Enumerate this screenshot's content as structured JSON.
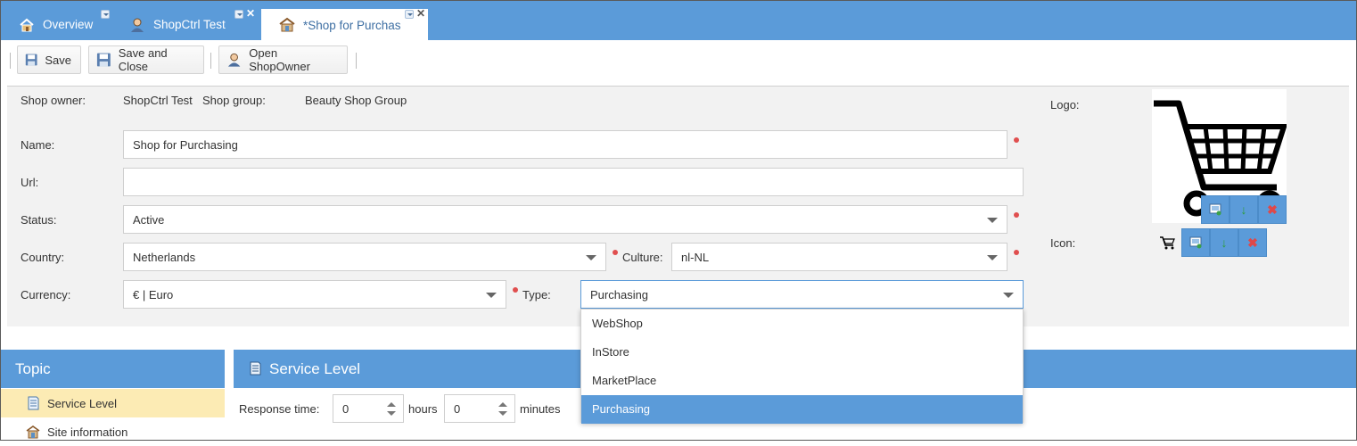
{
  "tabs": [
    {
      "label": "Overview",
      "icon": "house-icon"
    },
    {
      "label": "ShopCtrl Test",
      "icon": "user-icon"
    },
    {
      "label": "*Shop for Purchas",
      "icon": "shop-icon"
    }
  ],
  "toolbar": {
    "save_label": "Save",
    "save_close_label": "Save and Close",
    "open_owner_label": "Open ShopOwner"
  },
  "form": {
    "shop_owner_label": "Shop owner:",
    "shop_owner_value": "ShopCtrl Test",
    "shop_group_label": "Shop group:",
    "shop_group_value": "Beauty Shop Group",
    "name_label": "Name:",
    "name_value": "Shop for Purchasing",
    "url_label": "Url:",
    "url_value": "",
    "status_label": "Status:",
    "status_value": "Active",
    "country_label": "Country:",
    "country_value": "Netherlands",
    "culture_label": "Culture:",
    "culture_value": "nl-NL",
    "currency_label": "Currency:",
    "currency_value": "€ | Euro",
    "type_label": "Type:",
    "type_value": "Purchasing",
    "logo_label": "Logo:",
    "icon_label": "Icon:"
  },
  "type_dropdown": {
    "options": [
      "WebShop",
      "InStore",
      "MarketPlace",
      "Purchasing"
    ],
    "selected": "Purchasing"
  },
  "topic": {
    "title": "Topic",
    "items": [
      {
        "label": "Service Level",
        "icon": "document-icon"
      },
      {
        "label": "Site information",
        "icon": "shop-icon"
      }
    ]
  },
  "service_level": {
    "title": "Service Level",
    "response_time_label": "Response time:",
    "hours_value": "0",
    "hours_label": "hours",
    "minutes_value": "0",
    "minutes_label": "minutes"
  },
  "colors": {
    "accent": "#5b9bd9",
    "selected_topic": "#fcebb4",
    "required": "#e04f4f"
  }
}
